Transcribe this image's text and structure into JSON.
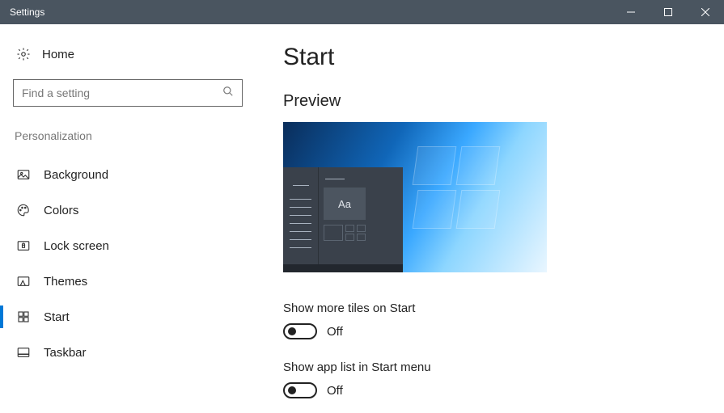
{
  "window": {
    "title": "Settings"
  },
  "sidebar": {
    "home_label": "Home",
    "search_placeholder": "Find a setting",
    "section_header": "Personalization",
    "items": [
      {
        "label": "Background",
        "icon": "picture",
        "selected": false
      },
      {
        "label": "Colors",
        "icon": "palette",
        "selected": false
      },
      {
        "label": "Lock screen",
        "icon": "lock-frame",
        "selected": false
      },
      {
        "label": "Themes",
        "icon": "brush",
        "selected": false
      },
      {
        "label": "Start",
        "icon": "start-grid",
        "selected": true
      },
      {
        "label": "Taskbar",
        "icon": "taskbar",
        "selected": false
      }
    ]
  },
  "main": {
    "title": "Start",
    "preview_title": "Preview",
    "preview_tile_text": "Aa",
    "settings": [
      {
        "label": "Show more tiles on Start",
        "state": "Off",
        "on": false
      },
      {
        "label": "Show app list in Start menu",
        "state": "Off",
        "on": false
      }
    ]
  }
}
